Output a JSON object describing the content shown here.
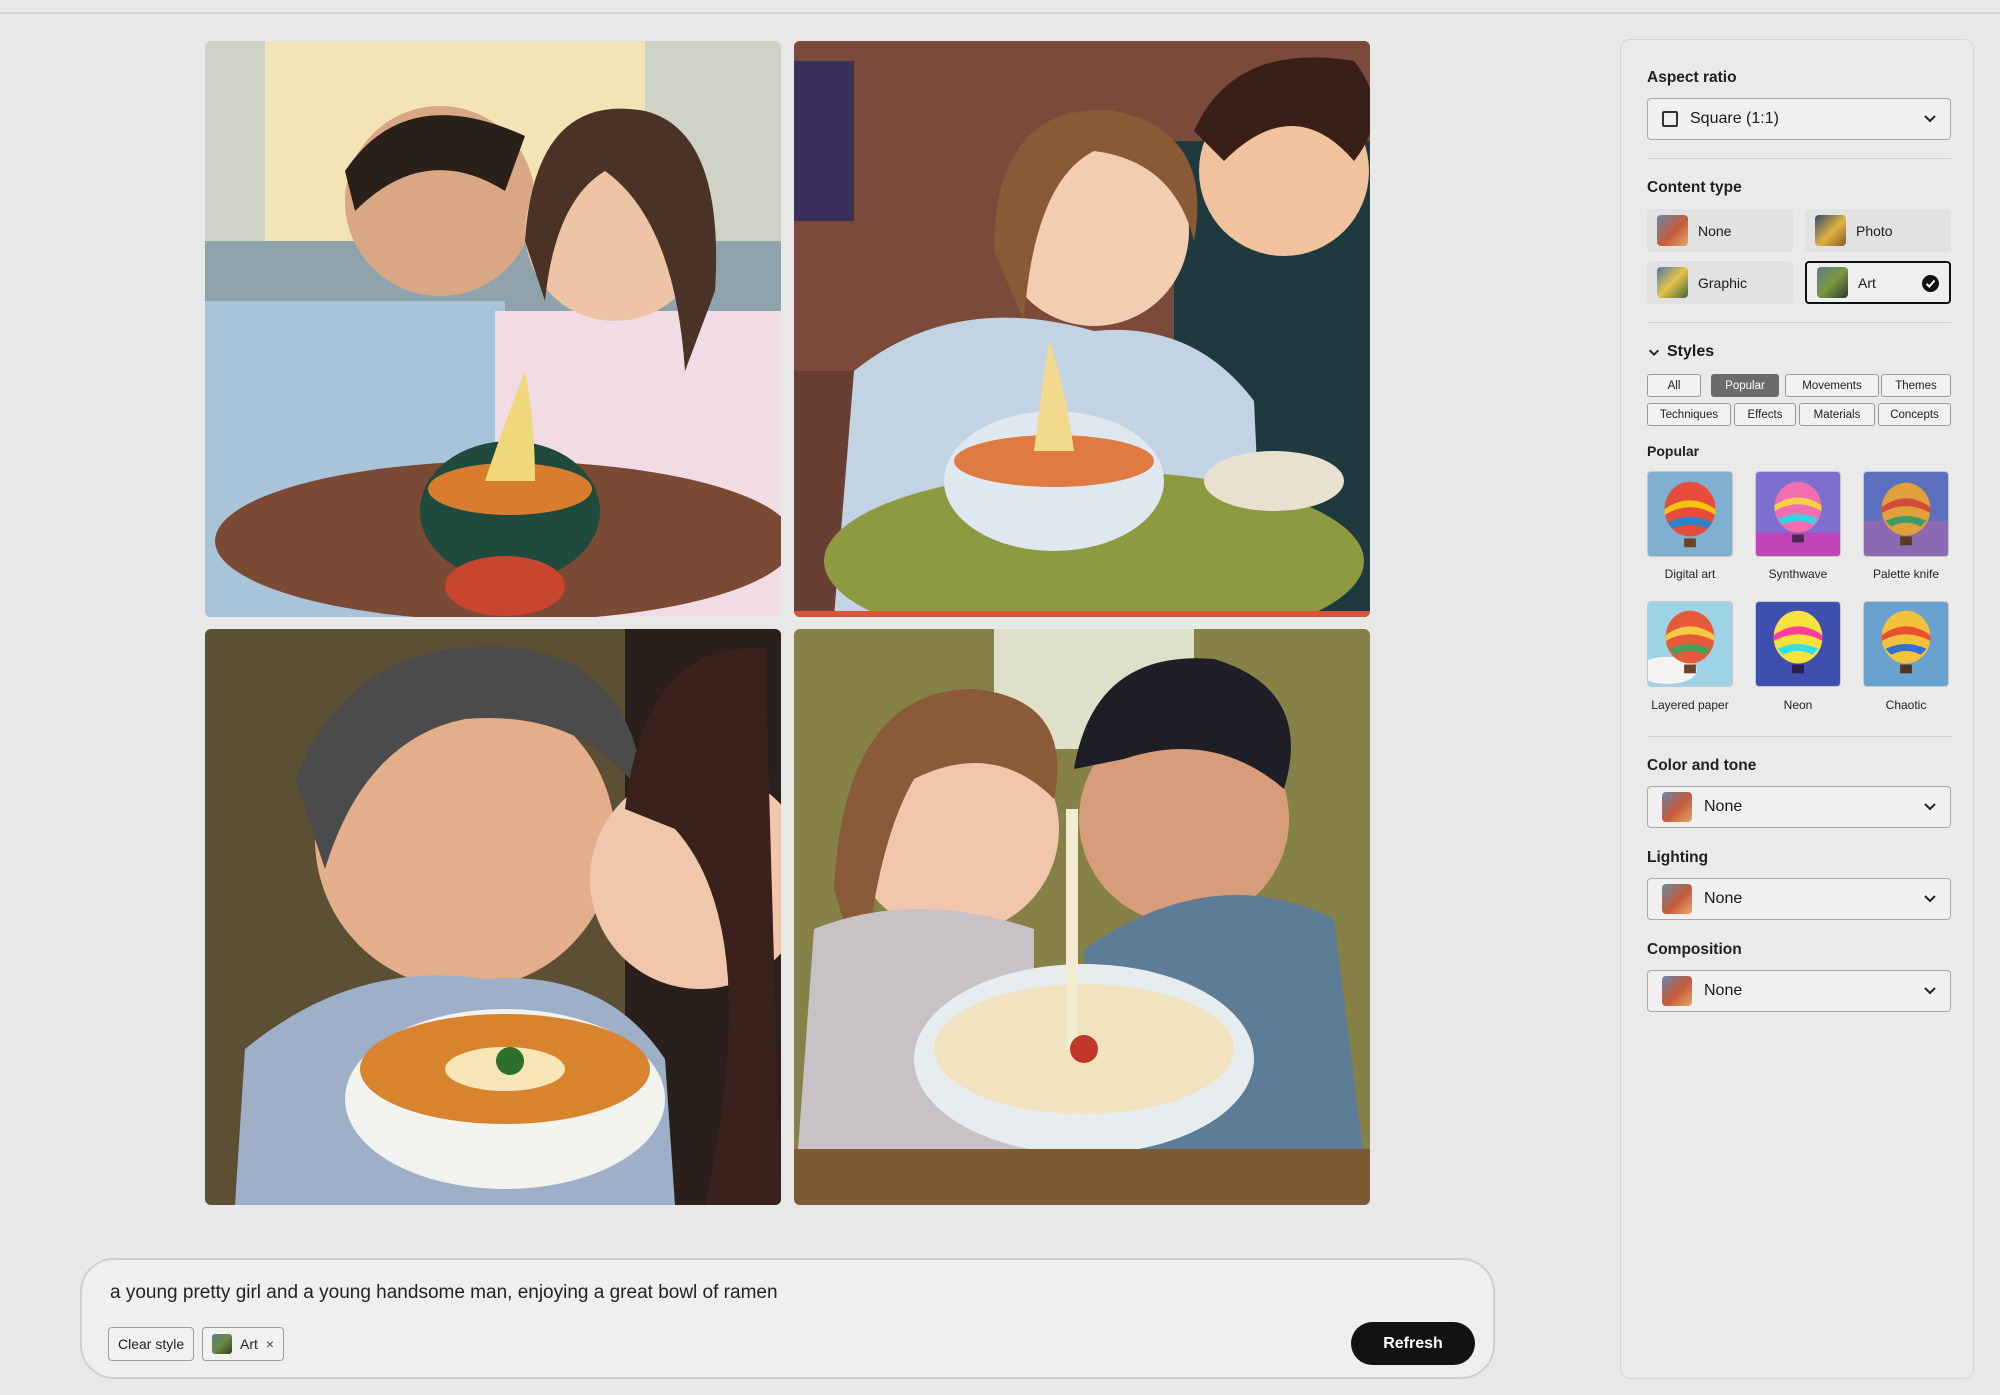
{
  "prompt": {
    "text": "a young pretty girl and a young handsome man, enjoying a great bowl of ramen",
    "clear_style_label": "Clear style",
    "style_chip_label": "Art",
    "style_chip_remove": "×",
    "refresh_label": "Refresh"
  },
  "panel": {
    "aspect_ratio": {
      "label": "Aspect ratio",
      "value": "Square (1:1)"
    },
    "content_type": {
      "label": "Content type",
      "options": [
        "None",
        "Photo",
        "Graphic",
        "Art"
      ],
      "selected": "Art"
    },
    "styles": {
      "label": "Styles",
      "tabs": [
        "All",
        "Popular",
        "Movements",
        "Themes",
        "Techniques",
        "Effects",
        "Materials",
        "Concepts"
      ],
      "active_tab": "Popular",
      "section_label": "Popular",
      "items": [
        "Digital art",
        "Synthwave",
        "Palette knife",
        "Layered paper",
        "Neon",
        "Chaotic"
      ]
    },
    "color_and_tone": {
      "label": "Color and tone",
      "value": "None"
    },
    "lighting": {
      "label": "Lighting",
      "value": "None"
    },
    "composition": {
      "label": "Composition",
      "value": "None"
    }
  },
  "icons": [
    "chevron-down-icon",
    "check-icon",
    "close-icon",
    "square-icon"
  ],
  "colors": {
    "refresh_bg": "#121212",
    "active_pill": "#6b6b6b",
    "page_bg": "#e8e8e8"
  }
}
